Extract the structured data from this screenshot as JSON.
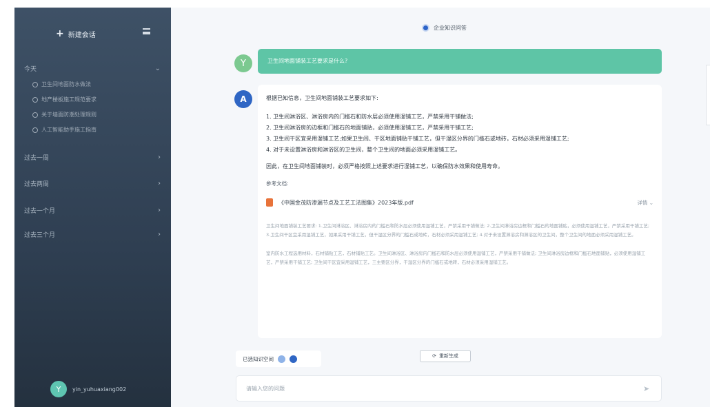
{
  "sidebar": {
    "new_chat_label": "新建会话",
    "groups": [
      {
        "label": "今天"
      },
      {
        "label": "过去一周"
      },
      {
        "label": "过去两周"
      },
      {
        "label": "过去一个月"
      },
      {
        "label": "过去三个月"
      }
    ],
    "history": [
      "卫生间地面防水做法",
      "地产楼板施工规范要求",
      "关于墙面防潮处理规则",
      "人工智能助手施工指南"
    ],
    "user": {
      "initial": "Y",
      "name": "yin_yuhuaxiang002"
    }
  },
  "main": {
    "kb_title": "企业知识问答",
    "question": {
      "avatar": "Y",
      "text": "卫生间地面铺装工艺要求是什么?"
    },
    "answer": {
      "avatar": "A",
      "intro": "根据已知信息，卫生间地面铺装工艺要求如下:",
      "items": [
        "1. 卫生间淋浴区、淋浴房内的门槛石和防水层必须使用湿铺工艺，严禁采用干铺做法;",
        "2. 卫生间淋浴房的边框和门槛石的地面铺贴，必须使用湿铺工艺，严禁采用干铺工艺;",
        "3. 卫生间干区宜采用湿铺工艺;如果卫生间、干区地面铺贴干铺工艺，但干湿区分界的门槛石或地砖，石材必须采用湿铺工艺;",
        "4. 对于未设置淋浴房和淋浴区的卫生间，整个卫生间的地面必须采用湿铺工艺。"
      ],
      "conclusion": "因此，在卫生间地面铺装时，必须严格按照上述要求进行湿铺工艺，以确保防水效果和使用寿命。",
      "ref_label": "参考文档:",
      "ref_file": "《中国金茂防渗漏节点及工艺工法图集》2023年版.pdf",
      "ref_detail": "详情",
      "excerpt_1": "卫生间地面铺装工艺要求: 1.卫生间淋浴区、淋浴房内的门槛石和防水层必须使用湿铺工艺，严禁采用干铺做法; 2.卫生间淋浴房边框和门槛石的地面铺贴，必须使用湿铺工艺，严禁采用干铺工艺; 3.卫生间干区宜采用湿铺工艺，如果采用干铺工艺，但干湿区分界的门槛石或地砖，石材必须采用湿铺工艺; 4.对于未设置淋浴房和淋浴区的卫生间，整个卫生间的地面必须采用湿铺工艺。",
      "excerpt_2": "室内防水工程选用材料，石材铺贴工艺，石材铺贴工艺。卫生间淋浴区、淋浴房内门槛石和防水层必须使用湿铺工艺，严禁采用干铺做法; 卫生间淋浴房边框和门槛石地面铺贴，必须使用湿铺工艺，严禁采用干铺工艺; 卫生间干区宜采用湿铺工艺，三主要区分界，干湿区分界的门槛石或地砖，石材必须采用湿铺工艺。"
    },
    "regenerate_label": "重新生成",
    "kb_selector_label": "已选知识空间",
    "input_placeholder": "请输入您的问题"
  }
}
